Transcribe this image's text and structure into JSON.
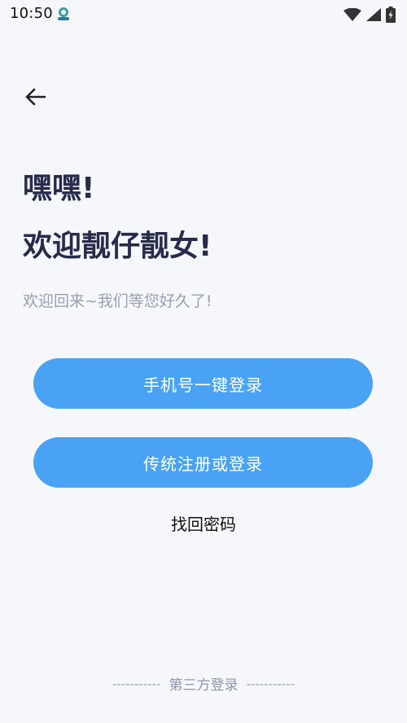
{
  "status_bar": {
    "time": "10:50",
    "app_icon": "app-notification-icon",
    "wifi_icon": "wifi-icon",
    "signal_icon": "cell-signal-icon",
    "battery_icon": "battery-charging-icon"
  },
  "nav": {
    "back_icon": "arrow-left-icon"
  },
  "headline": {
    "greeting": "嘿嘿!",
    "welcome": "欢迎靓仔靓女!",
    "subtitle": "欢迎回来~我们等您好久了!"
  },
  "actions": {
    "phone_login_label": "手机号一键登录",
    "register_login_label": "传统注册或登录",
    "forgot_password_label": "找回密码"
  },
  "footer": {
    "third_party_label": "第三方登录",
    "left_dashes": "-----------",
    "right_dashes": "-----------"
  },
  "colors": {
    "background": "#f6f7fb",
    "primary_button": "#4aa2f5",
    "heading_text": "#272c4a",
    "subtle_text": "#9aa0ad"
  }
}
